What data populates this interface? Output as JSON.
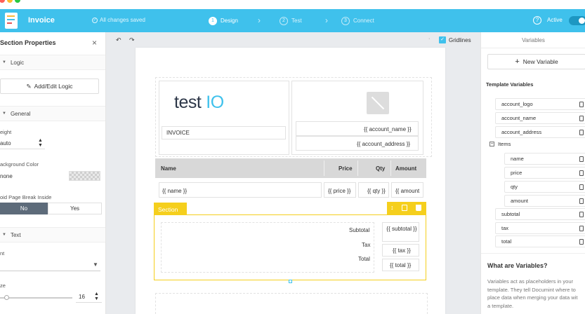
{
  "app": {
    "title": "Invoice",
    "save_status": "All changes saved",
    "active_label": "Active"
  },
  "steps": [
    {
      "num": "1",
      "label": "Design"
    },
    {
      "num": "2",
      "label": "Test"
    },
    {
      "num": "3",
      "label": "Connect"
    }
  ],
  "toolbar": {
    "gridlines_label": "Gridlines"
  },
  "left_panel": {
    "title": "Section Properties",
    "logic_section": "Logic",
    "add_edit_logic": "Add/Edit Logic",
    "general_section": "General",
    "height_label": "eight",
    "height_value": "auto",
    "background_label": "ackground Color",
    "background_value": "none",
    "page_break_label": "oid Page Break Inside",
    "no_label": "No",
    "yes_label": "Yes",
    "text_section": "Text",
    "font_label": "nt",
    "size_label": "ze",
    "size_value": "16"
  },
  "canvas": {
    "logo_text": "test",
    "logo_accent": "IO",
    "invoice_label": "INVOICE",
    "account_name": "{{ account_name }}",
    "account_address": "{{ account_address }}",
    "headers": {
      "name": "Name",
      "price": "Price",
      "qty": "Qty",
      "amount": "Amount"
    },
    "row": {
      "name": "{{ name }}",
      "price": "{{ price }}",
      "qty": "{{ qty }}",
      "amount": "{{ amount"
    },
    "section_tag": "Section",
    "subtotal_label": "Subtotal",
    "subtotal_value": "{{ subtotal }}",
    "tax_label": "Tax",
    "tax_value": "{{ tax }}",
    "total_label": "Total",
    "total_value": "{{ total }}"
  },
  "right_panel": {
    "title": "Variables",
    "new_variable": "New Variable",
    "template_variables": "Template Variables",
    "variables": [
      "account_logo",
      "account_name",
      "account_address"
    ],
    "items_label": "Items",
    "item_children": [
      "name",
      "price",
      "qty",
      "amount"
    ],
    "after_items": [
      "subtotal",
      "tax",
      "total"
    ],
    "what_title": "What are Variables?",
    "what_text_1": "Variables act as placeholders in your",
    "what_text_2": "template. They tell Documint where to",
    "what_text_3": "place data when merging your data wit",
    "what_text_4": "a template."
  },
  "colors": {
    "brand": "#3fc1ec",
    "selection": "#f5cf1d",
    "logo_text": "#2d3748",
    "logo_accent": "#3fc1ec"
  }
}
